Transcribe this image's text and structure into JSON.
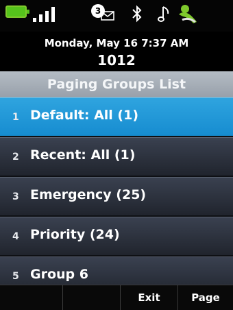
{
  "status": {
    "battery_icon": "battery-full-icon",
    "signal_icon": "signal-strength-icon",
    "message_count": "3",
    "message_icon": "envelope-icon",
    "bluetooth_icon": "bluetooth-icon",
    "ringer_icon": "music-note-icon",
    "phone_icon": "phone-handset-icon",
    "battery_color": "#55c31c"
  },
  "header": {
    "datetime": "Monday, May 16 7:37 AM",
    "extension": "1012"
  },
  "list": {
    "title": "Paging Groups List",
    "items": [
      {
        "num": "1",
        "label": "Default: All (1)",
        "selected": true
      },
      {
        "num": "2",
        "label": "Recent: All (1)",
        "selected": false
      },
      {
        "num": "3",
        "label": "Emergency (25)",
        "selected": false
      },
      {
        "num": "4",
        "label": "Priority (24)",
        "selected": false
      },
      {
        "num": "5",
        "label": "Group 6",
        "selected": false
      }
    ]
  },
  "softkeys": {
    "key1": "",
    "key2": "",
    "exit": "Exit",
    "page": "Page"
  },
  "colors": {
    "selected": "#1e96d6",
    "row": "#2c323e"
  }
}
